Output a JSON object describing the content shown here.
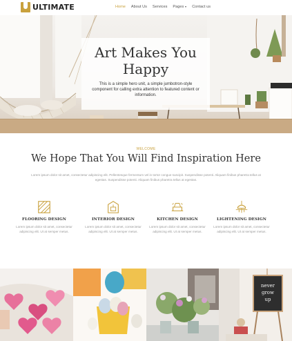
{
  "brand": {
    "name": "ULTIMATE"
  },
  "nav": {
    "items": [
      {
        "label": "Home",
        "active": true
      },
      {
        "label": "About Us",
        "active": false
      },
      {
        "label": "Services",
        "active": false
      },
      {
        "label": "Pages",
        "active": false,
        "dropdown": true
      },
      {
        "label": "Contact us",
        "active": false
      }
    ]
  },
  "hero": {
    "title": "Art Makes You Happy",
    "text": "This is a simple hero unit, a simple jumbotron-style component for calling extra attention to featured content or information."
  },
  "intro": {
    "eyebrow": "WELCOME",
    "title": "We Hope That You Will Find Inspiration Here",
    "description": "Lorem ipsum dolor sit amet, consectetur adipiscing elit. Pellentesque fermentum vel in tortor congue suscipit. Suspendisse potenti. Aliquam finibus pharetra tellus at egestas. Suspendisse potenti. Aliquam finibus pharetra tellus at egestas."
  },
  "features": [
    {
      "icon": "flooring-icon",
      "title": "FLOORING DESIGN",
      "desc": "Lorem ipsum dolor sit amet, consectetur adipiscing elit. Ut at semper metus."
    },
    {
      "icon": "interior-icon",
      "title": "INTERIOR DESIGN",
      "desc": "Lorem ipsum dolor sit amet, consectetur adipiscing elit. Ut at semper metus."
    },
    {
      "icon": "kitchen-icon",
      "title": "KITCHEN DESIGN",
      "desc": "Lorem ipsum dolor sit amet, consectetur adipiscing elit. Ut at semper metus."
    },
    {
      "icon": "lighting-icon",
      "title": "LIGHTENING DESIGN",
      "desc": "Lorem ipsum dolor sit amet, consectetur adipiscing elit. Ut at semper metus."
    }
  ],
  "gallery": {
    "images": [
      {
        "name": "gallery-image-hearts"
      },
      {
        "name": "gallery-image-easter-eggs"
      },
      {
        "name": "gallery-image-flowers"
      },
      {
        "name": "gallery-image-chalkboard",
        "sign_text": "never grow up"
      }
    ]
  },
  "colors": {
    "accent": "#c9a13d",
    "text": "#333333",
    "muted": "#999999"
  }
}
